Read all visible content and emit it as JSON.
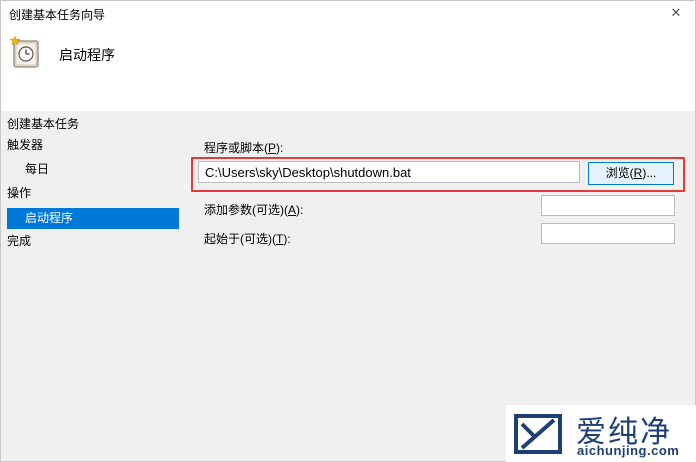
{
  "window": {
    "title": "创建基本任务向导",
    "close_glyph": "✕"
  },
  "header": {
    "title": "启动程序",
    "icon": "task-clock-icon"
  },
  "sidebar": {
    "heading": "创建基本任务",
    "items": [
      {
        "label": "触发器",
        "active": false,
        "indent": false
      },
      {
        "label": "每日",
        "active": false,
        "indent": true
      },
      {
        "label": "操作",
        "active": false,
        "indent": false
      },
      {
        "label": "启动程序",
        "active": true,
        "indent": true
      },
      {
        "label": "完成",
        "active": false,
        "indent": false
      }
    ],
    "active_color": "#0078d7"
  },
  "form": {
    "program_label": "程序或脚本(",
    "program_key": "P",
    "program_label_end": "):",
    "program_value": "C:\\Users\\sky\\Desktop\\shutdown.bat",
    "browse_label": "浏览(",
    "browse_key": "R",
    "browse_label_end": ")...",
    "args_label": "添加参数(可选)(",
    "args_key": "A",
    "args_label_end": "):",
    "args_value": "",
    "start_label": "起始于(可选)(",
    "start_key": "T",
    "start_label_end": "):",
    "start_value": ""
  },
  "watermark": {
    "name": "爱纯净",
    "url": "aichunjing.com"
  },
  "colors": {
    "highlight": "#e53935",
    "accent": "#0078d7"
  }
}
